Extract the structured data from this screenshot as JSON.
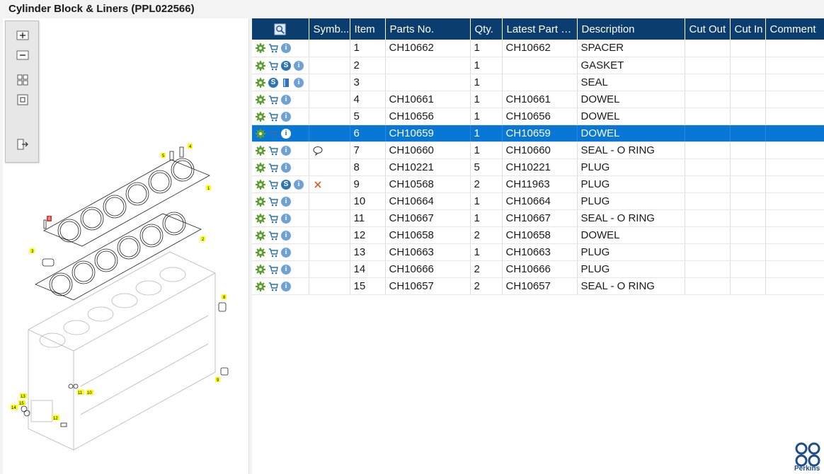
{
  "window": {
    "title": "Cylinder Block & Liners (PPL022566)"
  },
  "toolbar": {
    "buttons": [
      {
        "name": "zoom-in",
        "icon": "zoom-in-icon"
      },
      {
        "name": "zoom-out",
        "icon": "zoom-out-icon"
      },
      {
        "name": "fit-all",
        "icon": "fit-all-icon"
      },
      {
        "name": "actual-size",
        "icon": "actual-size-icon"
      },
      {
        "name": "export",
        "icon": "export-icon"
      }
    ]
  },
  "colors": {
    "header_bg": "#0c3d6f",
    "selected_row": "#0877d6",
    "callout_bg": "#ffff00",
    "brand": "#1f4d8a"
  },
  "grid": {
    "columns": [
      "",
      "Symb...",
      "Item",
      "Parts No.",
      "Qty.",
      "Latest Part No.",
      "Description",
      "Cut Out",
      "Cut In",
      "Comment"
    ],
    "rows": [
      {
        "icons": [
          "gear-icon",
          "cart-icon",
          "info-icon"
        ],
        "symbol": "",
        "item": "1",
        "part": "CH10662",
        "qty": "1",
        "latest": "CH10662",
        "desc": "SPACER"
      },
      {
        "icons": [
          "gear-icon",
          "cart-icon",
          "s-icon",
          "info-icon"
        ],
        "symbol": "",
        "item": "2",
        "part": "",
        "qty": "1",
        "latest": "",
        "desc": "GASKET"
      },
      {
        "icons": [
          "gear-icon",
          "s-icon",
          "book-icon",
          "info-icon"
        ],
        "symbol": "",
        "item": "3",
        "part": "",
        "qty": "1",
        "latest": "",
        "desc": "SEAL"
      },
      {
        "icons": [
          "gear-icon",
          "cart-icon",
          "info-icon"
        ],
        "symbol": "",
        "item": "4",
        "part": "CH10661",
        "qty": "1",
        "latest": "CH10661",
        "desc": "DOWEL"
      },
      {
        "icons": [
          "gear-icon",
          "cart-icon",
          "info-icon"
        ],
        "symbol": "",
        "item": "5",
        "part": "CH10656",
        "qty": "1",
        "latest": "CH10656",
        "desc": "DOWEL"
      },
      {
        "icons": [
          "gear-icon",
          "cart-icon",
          "info-icon"
        ],
        "symbol": "",
        "item": "6",
        "part": "CH10659",
        "qty": "1",
        "latest": "CH10659",
        "desc": "DOWEL",
        "selected": true
      },
      {
        "icons": [
          "gear-icon",
          "cart-icon",
          "info-icon"
        ],
        "symbol": "comment-icon",
        "item": "7",
        "part": "CH10660",
        "qty": "1",
        "latest": "CH10660",
        "desc": "SEAL - O RING"
      },
      {
        "icons": [
          "gear-icon",
          "cart-icon",
          "info-icon"
        ],
        "symbol": "",
        "item": "8",
        "part": "CH10221",
        "qty": "5",
        "latest": "CH10221",
        "desc": "PLUG"
      },
      {
        "icons": [
          "gear-icon",
          "cart-icon",
          "s-icon",
          "info-icon"
        ],
        "symbol": "cross-icon",
        "item": "9",
        "part": "CH10568",
        "qty": "2",
        "latest": "CH11963",
        "desc": "PLUG"
      },
      {
        "icons": [
          "gear-icon",
          "cart-icon",
          "info-icon"
        ],
        "symbol": "",
        "item": "10",
        "part": "CH10664",
        "qty": "1",
        "latest": "CH10664",
        "desc": "PLUG"
      },
      {
        "icons": [
          "gear-icon",
          "cart-icon",
          "info-icon"
        ],
        "symbol": "",
        "item": "11",
        "part": "CH10667",
        "qty": "1",
        "latest": "CH10667",
        "desc": "SEAL - O RING"
      },
      {
        "icons": [
          "gear-icon",
          "cart-icon",
          "info-icon"
        ],
        "symbol": "",
        "item": "12",
        "part": "CH10658",
        "qty": "2",
        "latest": "CH10658",
        "desc": "DOWEL"
      },
      {
        "icons": [
          "gear-icon",
          "cart-icon",
          "info-icon"
        ],
        "symbol": "",
        "item": "13",
        "part": "CH10663",
        "qty": "1",
        "latest": "CH10663",
        "desc": "PLUG"
      },
      {
        "icons": [
          "gear-icon",
          "cart-icon",
          "info-icon"
        ],
        "symbol": "",
        "item": "14",
        "part": "CH10666",
        "qty": "2",
        "latest": "CH10666",
        "desc": "PLUG"
      },
      {
        "icons": [
          "gear-icon",
          "cart-icon",
          "info-icon"
        ],
        "symbol": "",
        "item": "15",
        "part": "CH10657",
        "qty": "2",
        "latest": "CH10657",
        "desc": "SEAL - O RING"
      }
    ]
  },
  "diagram": {
    "callouts": [
      "1",
      "2",
      "3",
      "4",
      "5",
      "8",
      "9",
      "10",
      "11",
      "12",
      "13",
      "14",
      "15"
    ],
    "highlighted_callout": "6"
  },
  "logo": {
    "text": "Perkins"
  }
}
